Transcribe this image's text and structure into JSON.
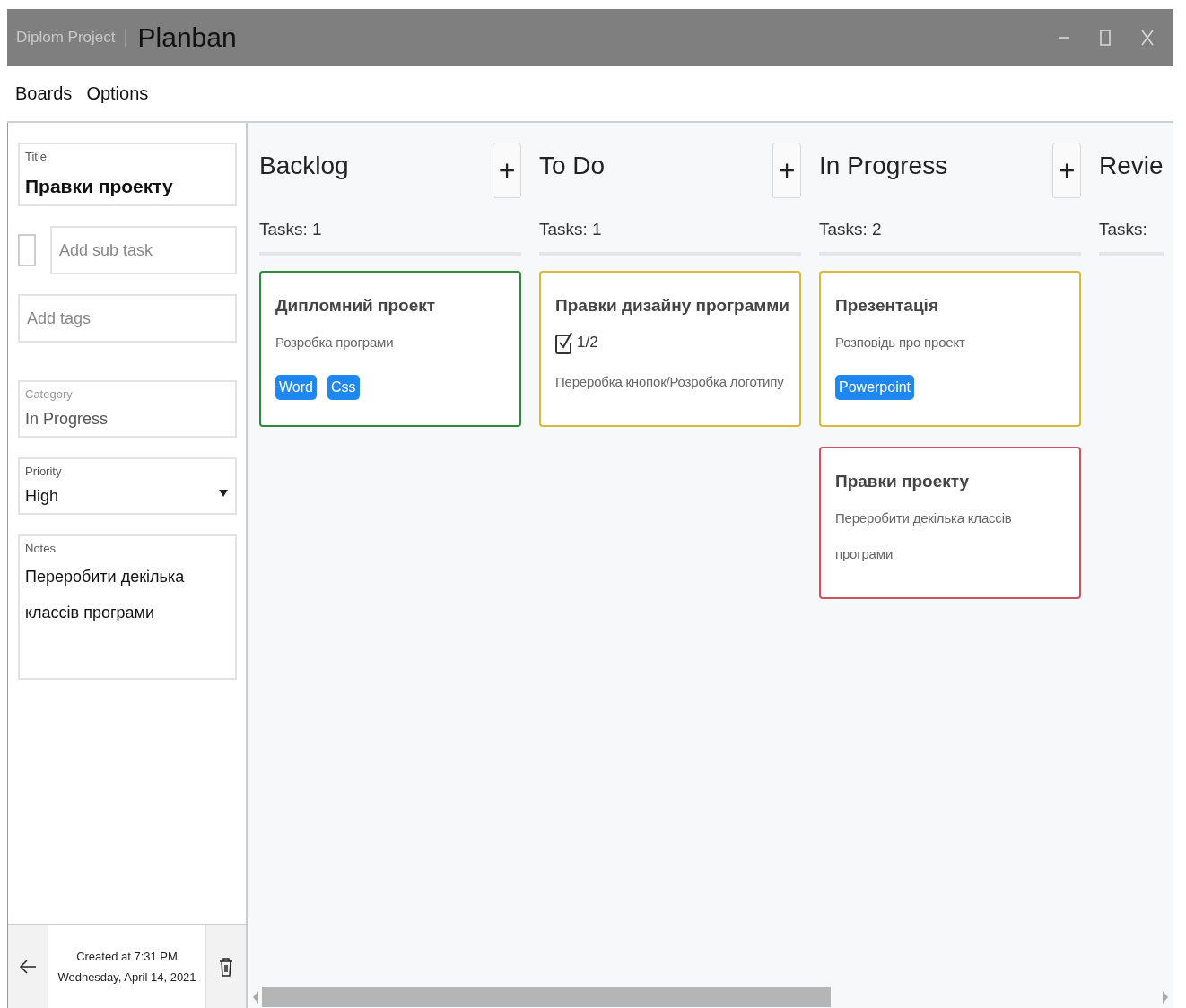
{
  "window": {
    "project": "Diplom Project",
    "title": "Planban"
  },
  "menu": [
    {
      "label": "Boards"
    },
    {
      "label": "Options"
    }
  ],
  "editor": {
    "title": {
      "label": "Title",
      "value": "Правки проекту"
    },
    "subtask": {
      "checked": false,
      "placeholder": "Add sub task"
    },
    "tags": {
      "placeholder": "Add tags"
    },
    "category": {
      "label": "Category",
      "value": "In Progress",
      "disabled": true
    },
    "priority": {
      "label": "Priority",
      "value": "High"
    },
    "notes": {
      "label": "Notes",
      "value": "Переробити декілька классів програми"
    },
    "created": [
      "Created at 7:31 PM",
      "Wednesday, April 14, 2021"
    ]
  },
  "columns": [
    {
      "title": "Backlog",
      "count": "Tasks: 1",
      "add": "+",
      "cards": [
        {
          "title": "Дипломний проект",
          "description": "Розробка програми",
          "color": "#2e8b3e",
          "tags": [
            "Word",
            "Css"
          ]
        }
      ]
    },
    {
      "title": "To Do",
      "count": "Tasks: 1",
      "add": "+",
      "cards": [
        {
          "title": "Правки дизайну программи",
          "subtasks": "1/2",
          "description": "Переробка кнопок/Розробка логотипу",
          "color": "#d9b83a"
        }
      ]
    },
    {
      "title": "In Progress",
      "count": "Tasks: 2",
      "add": "+",
      "cards": [
        {
          "title": "Презентація",
          "description": "Розповідь про проект",
          "color": "#d9b83a",
          "tags": [
            "Powerpoint"
          ]
        },
        {
          "title": "Правки проекту",
          "description": "Переробити декілька классів програми",
          "color": "#c9545f"
        }
      ]
    },
    {
      "title": "Revie",
      "count": "Tasks:"
    }
  ]
}
